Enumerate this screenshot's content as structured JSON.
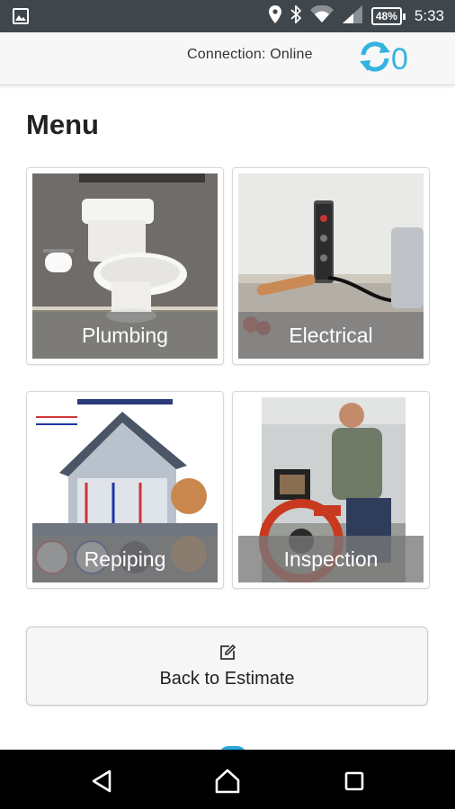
{
  "status_bar": {
    "battery": "48%",
    "time": "5:33",
    "icons": [
      "image-notification-icon",
      "location-icon",
      "bluetooth-icon",
      "wifi-icon",
      "signal-icon",
      "battery-icon"
    ]
  },
  "header": {
    "connection_status": "Connection: Online",
    "sync_count": "0",
    "sync_icon": "sync-icon",
    "accent": "#33b3e0"
  },
  "main": {
    "title": "Menu",
    "tiles": [
      {
        "label": "Plumbing"
      },
      {
        "label": "Electrical"
      },
      {
        "label": "Repiping"
      },
      {
        "label": "Inspection"
      }
    ],
    "back_button": {
      "label": "Back to Estimate",
      "icon": "edit-icon"
    }
  },
  "nav_bar": {
    "icons": [
      "back-icon",
      "home-icon",
      "recents-icon"
    ]
  }
}
